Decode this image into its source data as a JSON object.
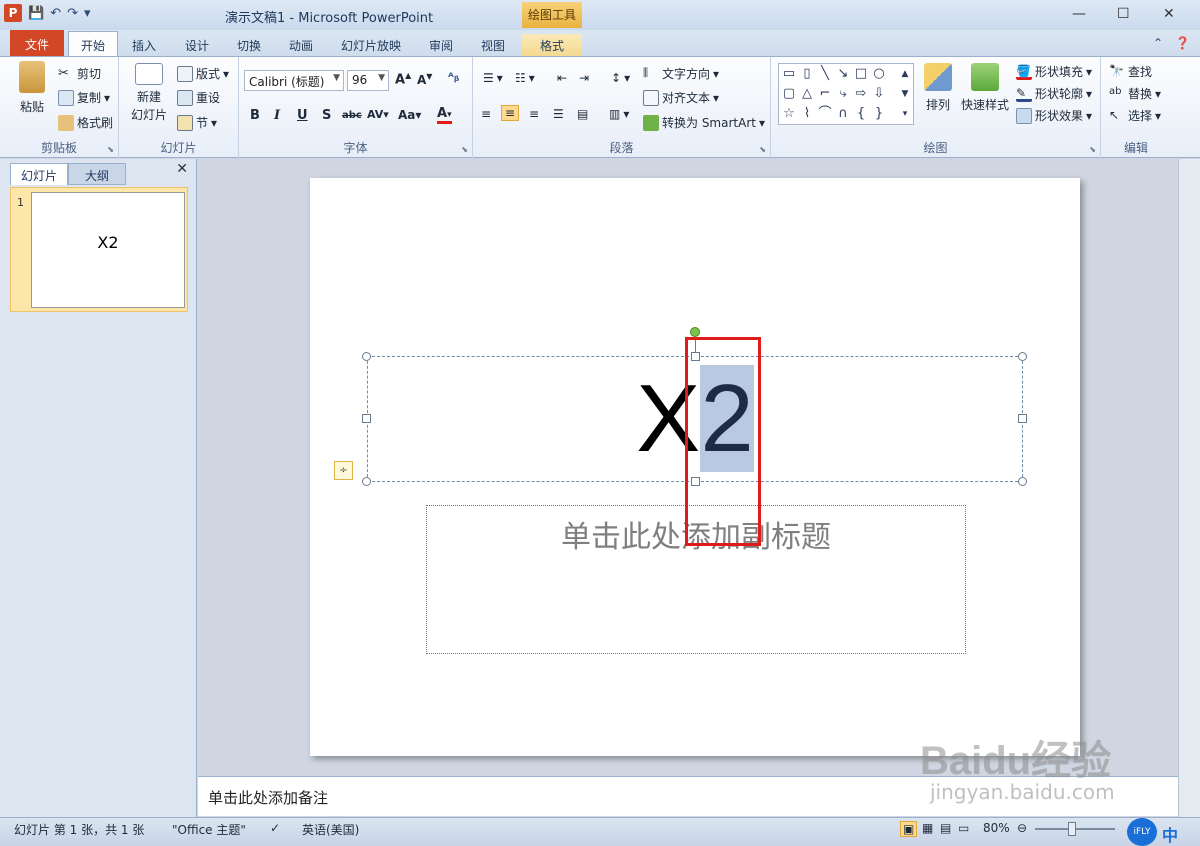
{
  "window": {
    "title": "演示文稿1 - Microsoft PowerPoint",
    "context_tab_group": "绘图工具",
    "minimize": "—",
    "maximize": "☐",
    "close": "✕"
  },
  "tabs": [
    "文件",
    "开始",
    "插入",
    "设计",
    "切换",
    "动画",
    "幻灯片放映",
    "审阅",
    "视图",
    "格式"
  ],
  "ribbon": {
    "clipboard": {
      "label": "剪贴板",
      "paste": "粘贴",
      "cut": "剪切",
      "copy": "复制",
      "format_painter": "格式刷"
    },
    "slides": {
      "label": "幻灯片",
      "new_slide_1": "新建",
      "new_slide_2": "幻灯片",
      "layout": "版式",
      "reset": "重设",
      "section": "节"
    },
    "font": {
      "label": "字体",
      "font_name": "Calibri (标题)",
      "font_size": "96",
      "bold": "B",
      "italic": "I",
      "underline": "U",
      "shadow": "S",
      "strike": "abc",
      "spacing": "AV",
      "case": "Aa",
      "color": "A"
    },
    "paragraph": {
      "label": "段落",
      "text_direction": "文字方向",
      "align_text": "对齐文本",
      "smartart": "转换为 SmartArt"
    },
    "drawing": {
      "label": "绘图",
      "arrange": "排列",
      "quick_styles": "快速样式",
      "shape_fill": "形状填充",
      "shape_outline": "形状轮廓",
      "shape_effects": "形状效果"
    },
    "editing": {
      "label": "编辑",
      "find": "查找",
      "replace": "替换",
      "select": "选择"
    }
  },
  "left_pane": {
    "tab_slides": "幻灯片",
    "tab_outline": "大纲",
    "close": "✕",
    "thumb_number": "1",
    "thumb_text": "X2"
  },
  "slide": {
    "title_prefix": "X",
    "title_selected": "2",
    "subtitle_placeholder": "单击此处添加副标题"
  },
  "notes": {
    "placeholder": "单击此处添加备注"
  },
  "status": {
    "slide_info": "幻灯片 第 1 张，共 1 张",
    "theme": "\"Office 主题\"",
    "language": "英语(美国)",
    "zoom": "80%"
  },
  "watermark": {
    "main": "Baidu经验",
    "sub": "jingyan.baidu.com"
  },
  "ime": {
    "ifly": "iFLY",
    "mode": "中"
  },
  "colors": {
    "file_tab": "#d24726",
    "selection": "#bac9e2",
    "annotation": "#e11b1b",
    "rotate_handle": "#7cc24a"
  }
}
